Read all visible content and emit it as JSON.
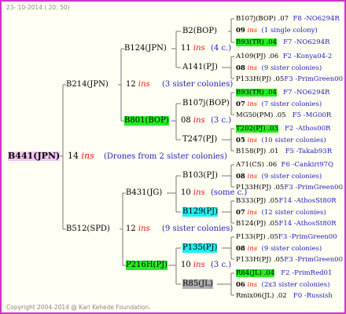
{
  "header": {
    "date": "23- 10-2014 ( 20: 50)"
  },
  "footer": {
    "copyright": "Copyright 2004-2014 @ Karl Kehede Foundation."
  },
  "root": {
    "label": "B441(JPN)",
    "ins": "14",
    "ins_word": "ins",
    "note": "(Drones from 2 sister colonies)"
  },
  "gen2": [
    {
      "label": "B214(JPN)",
      "ins": "12",
      "ins_word": "ins",
      "note": "(3 sister colonies)"
    },
    {
      "label": "B512(SPD)",
      "ins": "12",
      "ins_word": "ins",
      "note": "(9 sister colonies)"
    }
  ],
  "gen3": [
    {
      "label": "B124(JPN)",
      "ins": "11",
      "ins_word": "ins",
      "note": "(4 c.)"
    },
    {
      "label": "B801(BOP)",
      "ins": "08",
      "ins_word": "ins",
      "note": "(3 c.)"
    },
    {
      "label": "B431(JG)",
      "ins": "10",
      "ins_word": "ins",
      "note": "(some c.)"
    },
    {
      "label": "P216H(PJ)",
      "ins": "10",
      "ins_word": "ins",
      "note": "(3 c.)"
    }
  ],
  "gen4": [
    "B2(BOP)",
    "A141(PJ)",
    "B107j(BOP)",
    "T247(PJ)",
    "B103(PJ)",
    "B129(PJ)",
    "P135(PJ)",
    "R85(JL)"
  ],
  "gen5": [
    {
      "a": "B107j(BOP) .07",
      "b": "F8 -NO6294R",
      "n": "09",
      "w": "ins",
      "c": "(1 single colony)",
      "d": "B93(TR) .04",
      "e": "F7 -NO6294R"
    },
    {
      "a": "A109(PJ) .06",
      "b": "F2 -Konya04-2",
      "n": "08",
      "w": "ins",
      "c": "(9 sister colonies)",
      "d": "P133H(PJ) .05",
      "e": "F3 -PrimGreen00"
    },
    {
      "a": "B93(TR) .04",
      "b": "F7 -NO6294R",
      "n": "07",
      "w": "ins",
      "c": "(7 sister colonies)",
      "d": "MG50(PM) .05",
      "e": "F5 -MG00R"
    },
    {
      "a": "T202(PJ) .03",
      "b": "F2 -Athos00R",
      "n": "05",
      "w": "ins",
      "c": "(10 sister colonies)",
      "d": "B158(PJ) .01",
      "e": "F5 -Takab93R"
    },
    {
      "a": "A71(CS) .06",
      "b": "F6 -Cankiri97Q",
      "n": "08",
      "w": "ins",
      "c": "(9 sister colonies)",
      "d": "P133H(PJ) .05",
      "e": "F3 -PrimGreen00"
    },
    {
      "a": "B333(PJ) .05",
      "b": "F14 -AthosSt80R",
      "n": "07",
      "w": "ins",
      "c": "(12 sister colonies)",
      "d": "B124(PJ) .05",
      "e": "F14 -AthosSt80R"
    },
    {
      "a": "P133(PJ) .05",
      "b": "F3 -PrimGreen00",
      "n": "08",
      "w": "ins",
      "c": "(9 sister colonies)",
      "d": "P133H(PJ) .05",
      "e": "F3 -PrimGreen00"
    },
    {
      "a": "R84(JL) .04",
      "b": "F2 -PrimRed01",
      "n": "06",
      "w": "ins",
      "c": "(2x3 sister colonies)",
      "d": "Rmix06(JL) .02",
      "e": "F0 -Russish"
    }
  ]
}
